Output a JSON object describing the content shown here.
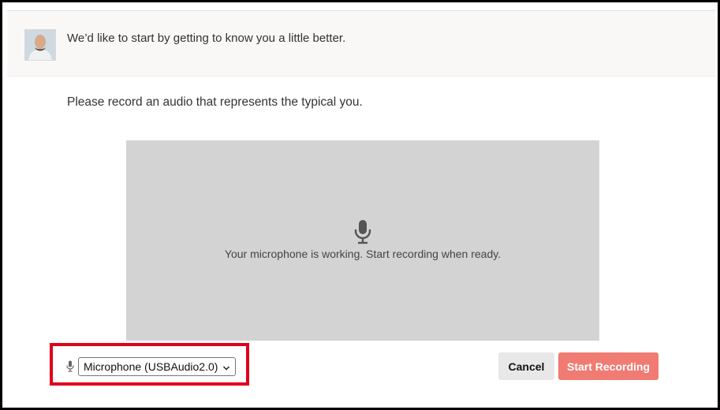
{
  "header": {
    "message": "We’d like to start by getting to know you a little better."
  },
  "main": {
    "prompt": "Please record an audio that represents the typical you.",
    "status_message": "Your microphone is working. Start recording when ready."
  },
  "controls": {
    "microphone_selected": "Microphone (USBAudio2.0)",
    "cancel_label": "Cancel",
    "start_label": "Start Recording"
  },
  "icons": {
    "status": "microphone-icon",
    "select": "microphone-icon",
    "dropdown": "chevron-down-icon"
  },
  "colors": {
    "stage_background": "#d3d3d3",
    "start_button": "#f07b72",
    "cancel_button": "#e8e8e8",
    "highlight_border": "#e0001b"
  }
}
